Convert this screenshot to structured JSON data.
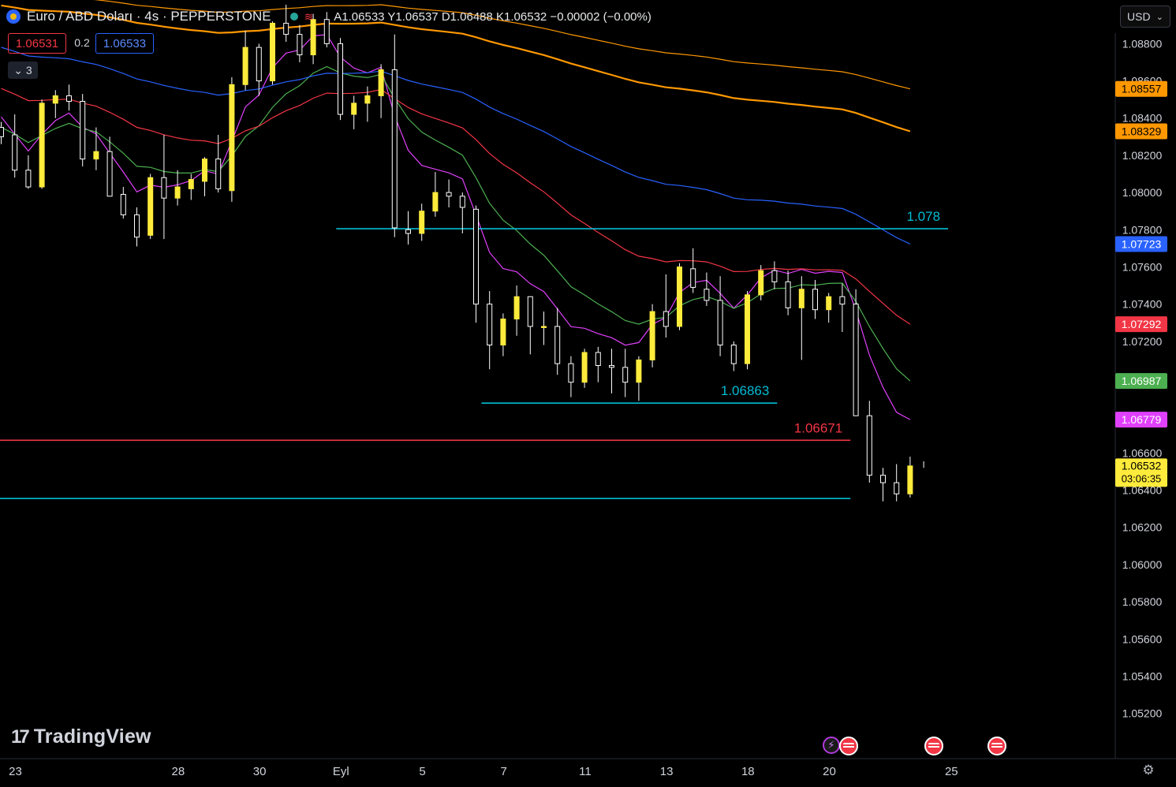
{
  "header": {
    "symbol": "Euro / ABD Doları · 4s · PEPPERSTONE",
    "ohlc": "A1.06533 Y1.06537 D1.06488 K1.06532 −0.00002 (−0.00%)"
  },
  "trade": {
    "sell": "1.06531",
    "spread": "0.2",
    "buy": "1.06533"
  },
  "indicators_toggle": "3",
  "currency": "USD",
  "brand": "TradingView",
  "icons": {
    "symbol": "euro-dollar-flag-icon",
    "status": "market-open-dot-icon",
    "indicator": "wave-icon",
    "collapse": "chevron-down-icon",
    "settings": "gear-icon",
    "events": [
      "flash-icon",
      "us-flag-event-icon"
    ]
  },
  "colors": {
    "background": "#000000",
    "candle": "#ffeb3b",
    "support_line": "#00bcd4",
    "resistance_line": "#f23645",
    "ema_magenta": "#e040fb",
    "ema_green": "#4caf50",
    "ema_red": "#f23645",
    "ema_blue": "#2962ff",
    "ema_orange": "#ff9800",
    "ema_gray": "#9e9e9e"
  },
  "chart_data": {
    "type": "candlestick",
    "title": "",
    "xlabel": "",
    "ylabel": "",
    "ylim": [
      1.0505,
      1.0895
    ],
    "x_ticks": [
      "23",
      "28",
      "30",
      "Eyl",
      "5",
      "7",
      "11",
      "13",
      "18",
      "20",
      "25"
    ],
    "x_tick_pos": [
      0,
      12,
      18,
      24,
      30,
      36,
      42,
      48,
      54,
      60,
      69
    ],
    "y_ticks": [
      "1.08800",
      "1.08600",
      "1.08400",
      "1.08200",
      "1.08000",
      "1.07800",
      "1.07600",
      "1.07400",
      "1.07200",
      "1.07000",
      "1.06800",
      "1.06600",
      "1.06400",
      "1.06200",
      "1.06000",
      "1.05800",
      "1.05600",
      "1.05400",
      "1.05200"
    ],
    "series": [
      {
        "name": "EMA",
        "color": "#e040fb",
        "last": 1.06779
      },
      {
        "name": "EMA",
        "color": "#4caf50",
        "last": 1.06987
      },
      {
        "name": "EMA",
        "color": "#f23645",
        "last": 1.07292
      },
      {
        "name": "EMA",
        "color": "#2962ff",
        "last": 1.07723
      },
      {
        "name": "EMA",
        "color": "#ff9800",
        "last": 1.08329
      },
      {
        "name": "EMA",
        "color": "#ff9800",
        "last": 1.08557
      }
    ],
    "price_badges": [
      {
        "value": "1.08557",
        "color": "#ff9800",
        "text": "#000000"
      },
      {
        "value": "1.08329",
        "color": "#ff9800",
        "text": "#000000"
      },
      {
        "value": "1.07723",
        "color": "#2962ff",
        "text": "#ffffff"
      },
      {
        "value": "1.07292",
        "color": "#f23645",
        "text": "#ffffff"
      },
      {
        "value": "1.06987",
        "color": "#4caf50",
        "text": "#ffffff"
      },
      {
        "value": "1.06779",
        "color": "#e040fb",
        "text": "#ffffff"
      }
    ],
    "current": {
      "price": "1.06532",
      "countdown": "03:06:35"
    },
    "hlines": [
      {
        "label": "1.078",
        "value": 1.07805,
        "color": "#00bcd4",
        "x_from": 24.7,
        "x_to": 69.8
      },
      {
        "label": "1.06863",
        "value": 1.06868,
        "color": "#00bcd4",
        "x_from": 35.4,
        "x_to": 57.2
      },
      {
        "label": "1.06671",
        "value": 1.06668,
        "color": "#f23645",
        "x_from": 0,
        "x_to": 62.6
      },
      {
        "label": "",
        "value": 1.06355,
        "color": "#00bcd4",
        "x_from": 0,
        "x_to": 62.6
      }
    ],
    "candles": [
      [
        1.0835,
        1.0838,
        1.0826,
        1.083
      ],
      [
        1.0831,
        1.0842,
        1.0808,
        1.0812
      ],
      [
        1.0812,
        1.082,
        1.0802,
        1.0803
      ],
      [
        1.0803,
        1.085,
        1.0802,
        1.0848
      ],
      [
        1.0848,
        1.0855,
        1.084,
        1.0852
      ],
      [
        1.0852,
        1.0858,
        1.0844,
        1.0849
      ],
      [
        1.0849,
        1.0853,
        1.0814,
        1.0818
      ],
      [
        1.0818,
        1.0835,
        1.0812,
        1.0822
      ],
      [
        1.0822,
        1.083,
        1.08,
        1.0798
      ],
      [
        1.0799,
        1.0803,
        1.0786,
        1.0788
      ],
      [
        1.0788,
        1.0792,
        1.0771,
        1.0776
      ],
      [
        1.0777,
        1.081,
        1.0775,
        1.0808
      ],
      [
        1.0808,
        1.0831,
        1.0775,
        1.0797
      ],
      [
        1.0797,
        1.0812,
        1.0793,
        1.0803
      ],
      [
        1.0802,
        1.081,
        1.0796,
        1.0807
      ],
      [
        1.0806,
        1.0819,
        1.0798,
        1.0818
      ],
      [
        1.0818,
        1.0831,
        1.08,
        1.0802
      ],
      [
        1.0801,
        1.0862,
        1.0795,
        1.0858
      ],
      [
        1.0858,
        1.0887,
        1.0855,
        1.0878
      ],
      [
        1.0878,
        1.088,
        1.0852,
        1.086
      ],
      [
        1.086,
        1.0892,
        1.0858,
        1.0891
      ],
      [
        1.0891,
        1.0901,
        1.0881,
        1.0885
      ],
      [
        1.0885,
        1.089,
        1.087,
        1.0874
      ],
      [
        1.0874,
        1.0896,
        1.0869,
        1.0893
      ],
      [
        1.0893,
        1.0897,
        1.0878,
        1.088
      ],
      [
        1.088,
        1.0883,
        1.0839,
        1.0842
      ],
      [
        1.0842,
        1.0852,
        1.0834,
        1.0848
      ],
      [
        1.0848,
        1.0857,
        1.0838,
        1.0852
      ],
      [
        1.0852,
        1.0869,
        1.084,
        1.0866
      ],
      [
        1.0866,
        1.0885,
        1.0776,
        1.0781
      ],
      [
        1.078,
        1.079,
        1.0772,
        1.0778
      ],
      [
        1.0778,
        1.0794,
        1.0774,
        1.079
      ],
      [
        1.079,
        1.0811,
        1.0787,
        1.08
      ],
      [
        1.08,
        1.0807,
        1.0792,
        1.0798
      ],
      [
        1.0798,
        1.08,
        1.0778,
        1.0792
      ],
      [
        1.0791,
        1.0793,
        1.073,
        1.074
      ],
      [
        1.074,
        1.0747,
        1.0705,
        1.0718
      ],
      [
        1.0718,
        1.0735,
        1.0712,
        1.0732
      ],
      [
        1.0732,
        1.075,
        1.0723,
        1.0744
      ],
      [
        1.0744,
        1.0744,
        1.0713,
        1.0728
      ],
      [
        1.0728,
        1.0736,
        1.0718,
        1.0728
      ],
      [
        1.0728,
        1.0738,
        1.0702,
        1.0708
      ],
      [
        1.0708,
        1.0712,
        1.069,
        1.0698
      ],
      [
        1.0698,
        1.0716,
        1.0695,
        1.0714
      ],
      [
        1.0714,
        1.0717,
        1.0698,
        1.0707
      ],
      [
        1.0707,
        1.0716,
        1.0692,
        1.0706
      ],
      [
        1.0706,
        1.0716,
        1.069,
        1.0698
      ],
      [
        1.0698,
        1.0712,
        1.0688,
        1.071
      ],
      [
        1.071,
        1.074,
        1.0706,
        1.0736
      ],
      [
        1.0736,
        1.0756,
        1.0722,
        1.0728
      ],
      [
        1.0728,
        1.0762,
        1.0726,
        1.076
      ],
      [
        1.0759,
        1.077,
        1.0746,
        1.0749
      ],
      [
        1.0748,
        1.0757,
        1.0739,
        1.0742
      ],
      [
        1.0742,
        1.0755,
        1.0712,
        1.0718
      ],
      [
        1.0718,
        1.072,
        1.0704,
        1.0708
      ],
      [
        1.0708,
        1.0747,
        1.0705,
        1.0745
      ],
      [
        1.0745,
        1.0761,
        1.0742,
        1.0758
      ],
      [
        1.0758,
        1.0763,
        1.0748,
        1.0752
      ],
      [
        1.0752,
        1.0758,
        1.0734,
        1.0738
      ],
      [
        1.0738,
        1.0755,
        1.071,
        1.0748
      ],
      [
        1.0748,
        1.0753,
        1.0732,
        1.0737
      ],
      [
        1.0737,
        1.0746,
        1.073,
        1.0744
      ],
      [
        1.0744,
        1.0751,
        1.0725,
        1.074
      ],
      [
        1.074,
        1.0748,
        1.0712,
        1.068
      ],
      [
        1.068,
        1.0688,
        1.0644,
        1.0648
      ],
      [
        1.0648,
        1.0652,
        1.0634,
        1.0644
      ],
      [
        1.0644,
        1.0654,
        1.0634,
        1.0638
      ],
      [
        1.0638,
        1.0658,
        1.0636,
        1.0653
      ]
    ]
  }
}
